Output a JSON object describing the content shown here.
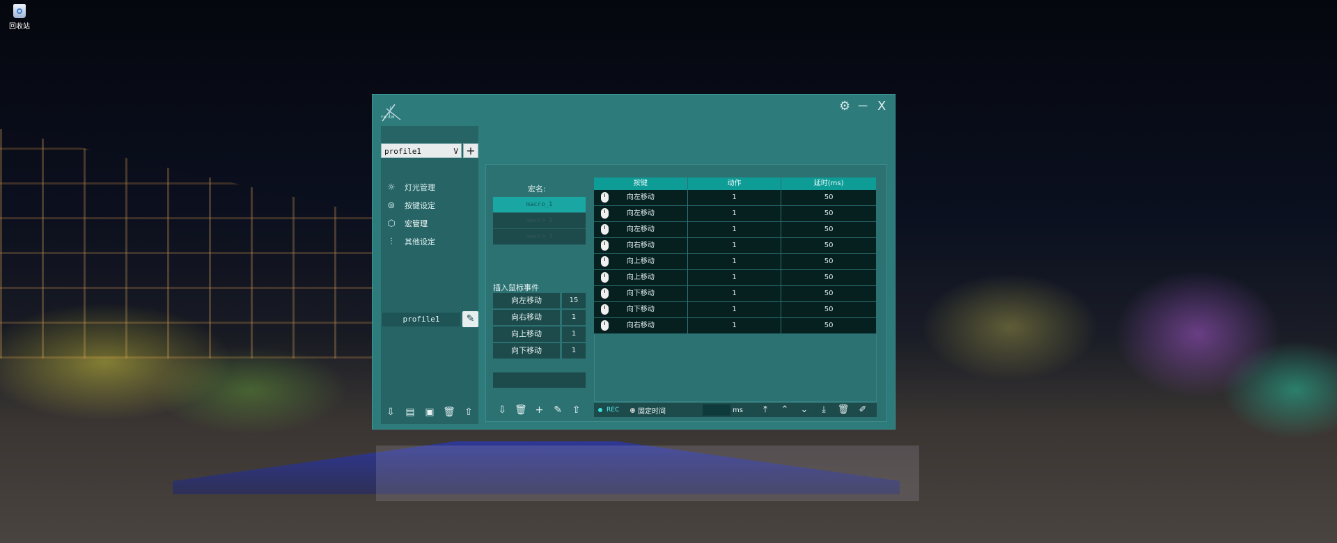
{
  "desktop": {
    "recycle_bin_label": "回收站"
  },
  "window": {
    "logo_text": "YK-KM",
    "settings_icon": "⚙",
    "minimize_icon": "—",
    "close_icon": "X"
  },
  "sidebar": {
    "profile_select": "profile1",
    "profile_dropdown_icon": "V",
    "add_profile_icon": "+",
    "nav": [
      {
        "label": "灯光管理",
        "icon": "sun-icon"
      },
      {
        "label": "按键设定",
        "icon": "keyboard-icon"
      },
      {
        "label": "宏管理",
        "icon": "cube-icon"
      },
      {
        "label": "其他设定",
        "icon": "sliders-icon"
      }
    ],
    "profile_name": "profile1"
  },
  "macro": {
    "title": "宏名:",
    "items": [
      "macro_1",
      "macro_2",
      "macro_3"
    ],
    "selected": "macro_1"
  },
  "mouse_events": {
    "title": "插入鼠标事件",
    "rows": [
      {
        "label": "向左移动",
        "value": "15"
      },
      {
        "label": "向右移动",
        "value": "1"
      },
      {
        "label": "向上移动",
        "value": "1"
      },
      {
        "label": "向下移动",
        "value": "1"
      }
    ]
  },
  "table": {
    "headers": [
      "按键",
      "动作",
      "延时(ms)"
    ],
    "rows": [
      {
        "key": "向左移动",
        "action": "1",
        "delay": "50"
      },
      {
        "key": "向左移动",
        "action": "1",
        "delay": "50"
      },
      {
        "key": "向左移动",
        "action": "1",
        "delay": "50"
      },
      {
        "key": "向右移动",
        "action": "1",
        "delay": "50"
      },
      {
        "key": "向上移动",
        "action": "1",
        "delay": "50"
      },
      {
        "key": "向上移动",
        "action": "1",
        "delay": "50"
      },
      {
        "key": "向下移动",
        "action": "1",
        "delay": "50"
      },
      {
        "key": "向下移动",
        "action": "1",
        "delay": "50"
      },
      {
        "key": "向右移动",
        "action": "1",
        "delay": "50"
      }
    ]
  },
  "bottom_bar": {
    "rec_label": "REC",
    "fixed_time_label": "固定时间",
    "ms_value": "",
    "ms_unit": "ms"
  },
  "colors": {
    "window_bg": "#2e7b7c",
    "accent": "#0e9c97",
    "row_bg": "#06201f"
  }
}
